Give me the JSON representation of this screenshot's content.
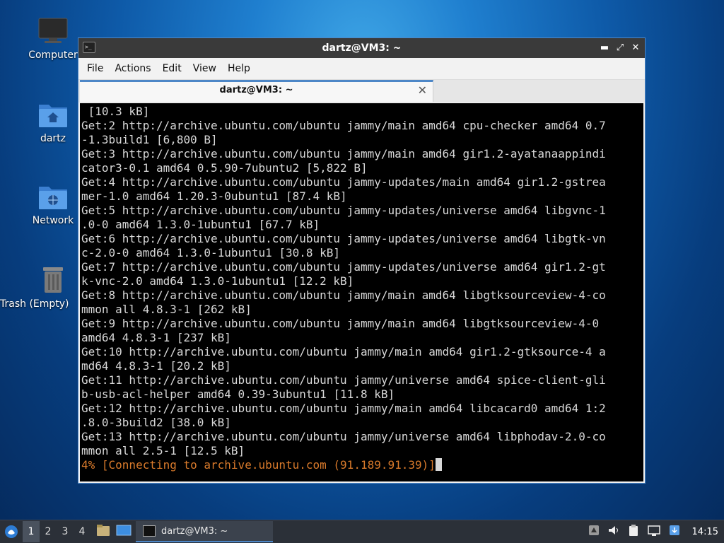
{
  "desktop": {
    "icons": [
      {
        "label": "Computer",
        "icon": "computer-icon"
      },
      {
        "label": "dartz",
        "icon": "home-folder-icon"
      },
      {
        "label": "Network",
        "icon": "network-folder-icon"
      },
      {
        "label": "Trash (Empty)",
        "icon": "trash-icon"
      }
    ]
  },
  "window": {
    "title": "dartz@VM3: ~",
    "menu": [
      "File",
      "Actions",
      "Edit",
      "View",
      "Help"
    ],
    "tab_label": "dartz@VM3: ~",
    "terminal_lines": [
      " [10.3 kB]",
      "Get:2 http://archive.ubuntu.com/ubuntu jammy/main amd64 cpu-checker amd64 0.7",
      "-1.3build1 [6,800 B]",
      "Get:3 http://archive.ubuntu.com/ubuntu jammy/main amd64 gir1.2-ayatanaappindi",
      "cator3-0.1 amd64 0.5.90-7ubuntu2 [5,822 B]",
      "Get:4 http://archive.ubuntu.com/ubuntu jammy-updates/main amd64 gir1.2-gstrea",
      "mer-1.0 amd64 1.20.3-0ubuntu1 [87.4 kB]",
      "Get:5 http://archive.ubuntu.com/ubuntu jammy-updates/universe amd64 libgvnc-1",
      ".0-0 amd64 1.3.0-1ubuntu1 [67.7 kB]",
      "Get:6 http://archive.ubuntu.com/ubuntu jammy-updates/universe amd64 libgtk-vn",
      "c-2.0-0 amd64 1.3.0-1ubuntu1 [30.8 kB]",
      "Get:7 http://archive.ubuntu.com/ubuntu jammy-updates/universe amd64 gir1.2-gt",
      "k-vnc-2.0 amd64 1.3.0-1ubuntu1 [12.2 kB]",
      "Get:8 http://archive.ubuntu.com/ubuntu jammy/main amd64 libgtksourceview-4-co",
      "mmon all 4.8.3-1 [262 kB]",
      "Get:9 http://archive.ubuntu.com/ubuntu jammy/main amd64 libgtksourceview-4-0",
      "amd64 4.8.3-1 [237 kB]",
      "Get:10 http://archive.ubuntu.com/ubuntu jammy/main amd64 gir1.2-gtksource-4 a",
      "md64 4.8.3-1 [20.2 kB]",
      "Get:11 http://archive.ubuntu.com/ubuntu jammy/universe amd64 spice-client-gli",
      "b-usb-acl-helper amd64 0.39-3ubuntu1 [11.8 kB]",
      "Get:12 http://archive.ubuntu.com/ubuntu jammy/main amd64 libcacard0 amd64 1:2",
      ".8.0-3build2 [38.0 kB]",
      "Get:13 http://archive.ubuntu.com/ubuntu jammy/universe amd64 libphodav-2.0-co",
      "mmon all 2.5-1 [12.5 kB]"
    ],
    "status_line": "4% [Connecting to archive.ubuntu.com (91.189.91.39)]"
  },
  "taskbar": {
    "workspaces": [
      "1",
      "2",
      "3",
      "4"
    ],
    "active_task": "dartz@VM3: ~",
    "clock": "14:15"
  },
  "colors": {
    "accent": "#4d87c7",
    "status_text": "#d97a2b"
  }
}
